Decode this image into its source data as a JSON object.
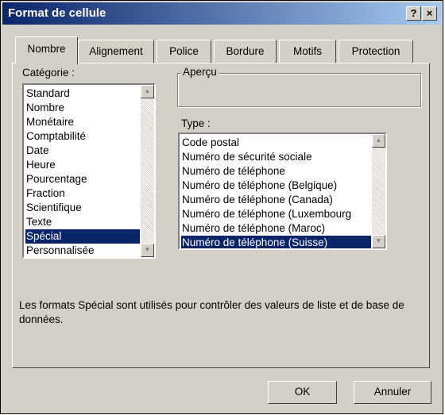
{
  "window": {
    "title": "Format de cellule",
    "help_label": "?",
    "close_label": "×"
  },
  "tabs": [
    {
      "label": "Nombre",
      "active": true
    },
    {
      "label": "Alignement",
      "active": false
    },
    {
      "label": "Police",
      "active": false
    },
    {
      "label": "Bordure",
      "active": false
    },
    {
      "label": "Motifs",
      "active": false
    },
    {
      "label": "Protection",
      "active": false
    }
  ],
  "category": {
    "label": "Catégorie :",
    "items": [
      "Standard",
      "Nombre",
      "Monétaire",
      "Comptabilité",
      "Date",
      "Heure",
      "Pourcentage",
      "Fraction",
      "Scientifique",
      "Texte",
      "Spécial",
      "Personnalisée"
    ],
    "selected": "Spécial"
  },
  "preview": {
    "label": "Aperçu"
  },
  "type": {
    "label": "Type :",
    "items": [
      "Code postal",
      "Numéro de sécurité sociale",
      "Numéro de téléphone",
      "Numéro de téléphone (Belgique)",
      "Numéro de téléphone (Canada)",
      "Numéro de téléphone (Luxembourg",
      "Numéro de téléphone (Maroc)",
      "Numéro de téléphone (Suisse)"
    ],
    "selected": "Numéro de téléphone (Suisse)"
  },
  "description": "Les formats Spécial sont utilisés pour contrôler des valeurs de liste et de base de données.",
  "buttons": {
    "ok": "OK",
    "cancel": "Annuler"
  },
  "colors": {
    "titlebar_start": "#0a246a",
    "titlebar_end": "#a6caf0",
    "selection": "#0a246a",
    "face": "#d4d0c8"
  }
}
